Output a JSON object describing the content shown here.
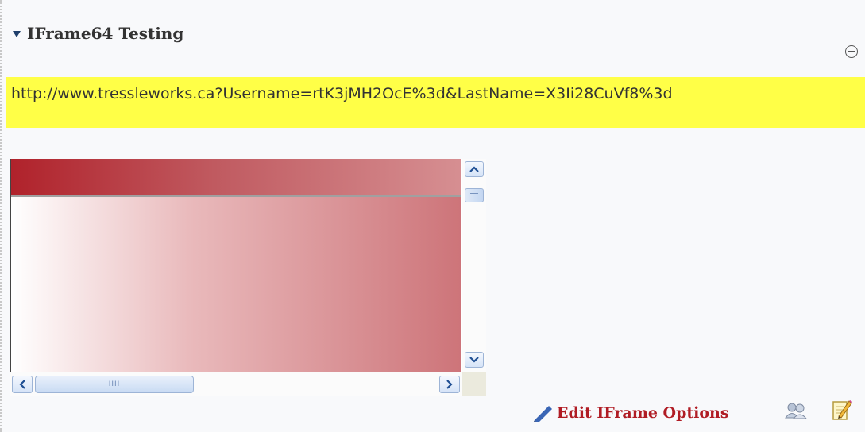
{
  "webpart": {
    "title": "IFrame64 Testing",
    "url_text": "http://www.tressleworks.ca?Username=rtK3jMH2OcE%3d&LastName=X3Ii28CuVf8%3d"
  },
  "iframe": {
    "hscroll_grip": "IIII",
    "band_color_start": "#b0222b",
    "band_color_end": "#d68f92",
    "body_gradient_end": "#cd7479"
  },
  "footer": {
    "edit_label": "Edit IFrame Options",
    "edit_color": "#b01c24"
  },
  "icons": {
    "collapse": "collapse-icon",
    "pencil": "pencil-icon",
    "people": "people-icon",
    "edit_note": "edit-note-icon"
  },
  "colors": {
    "highlight": "#ffff47"
  }
}
